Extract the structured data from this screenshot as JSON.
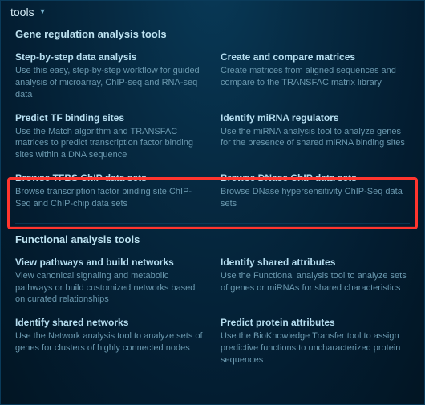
{
  "header": {
    "title": "tools"
  },
  "sections": {
    "geneRegulation": {
      "title": "Gene regulation analysis tools",
      "items": [
        {
          "title": "Step-by-step data analysis",
          "desc": "Use this easy, step-by-step workflow for guided analysis of microarray, ChIP-seq and RNA-seq data"
        },
        {
          "title": "Create and compare matrices",
          "desc": "Create matrices from aligned sequences and compare to the TRANSFAC matrix library"
        },
        {
          "title": "Predict TF binding sites",
          "desc": "Use the Match algorithm and TRANSFAC matrices to predict transcription factor binding sites within a DNA sequence"
        },
        {
          "title": "Identify miRNA regulators",
          "desc": "Use the miRNA analysis tool to analyze genes for the presence of shared miRNA binding sites"
        },
        {
          "title": "Browse TFBS ChIP data sets",
          "desc": "Browse transcription factor binding site ChIP-Seq and ChIP-chip data sets"
        },
        {
          "title": "Browse DNase ChIP data sets",
          "desc": "Browse DNase hypersensitivity ChIP-Seq data sets"
        }
      ]
    },
    "functional": {
      "title": "Functional analysis tools",
      "items": [
        {
          "title": "View pathways and build networks",
          "desc": "View canonical signaling and metabolic pathways or build customized networks based on curated relationships"
        },
        {
          "title": "Identify shared attributes",
          "desc": "Use the Functional analysis tool to analyze sets of genes or miRNAs for shared characteristics"
        },
        {
          "title": "Identify shared networks",
          "desc": "Use the Network analysis tool to analyze sets of genes for clusters of highly connected nodes"
        },
        {
          "title": "Predict protein attributes",
          "desc": "Use the BioKnowledge Transfer tool to assign predictive functions to uncharacterized protein sequences"
        }
      ]
    }
  }
}
